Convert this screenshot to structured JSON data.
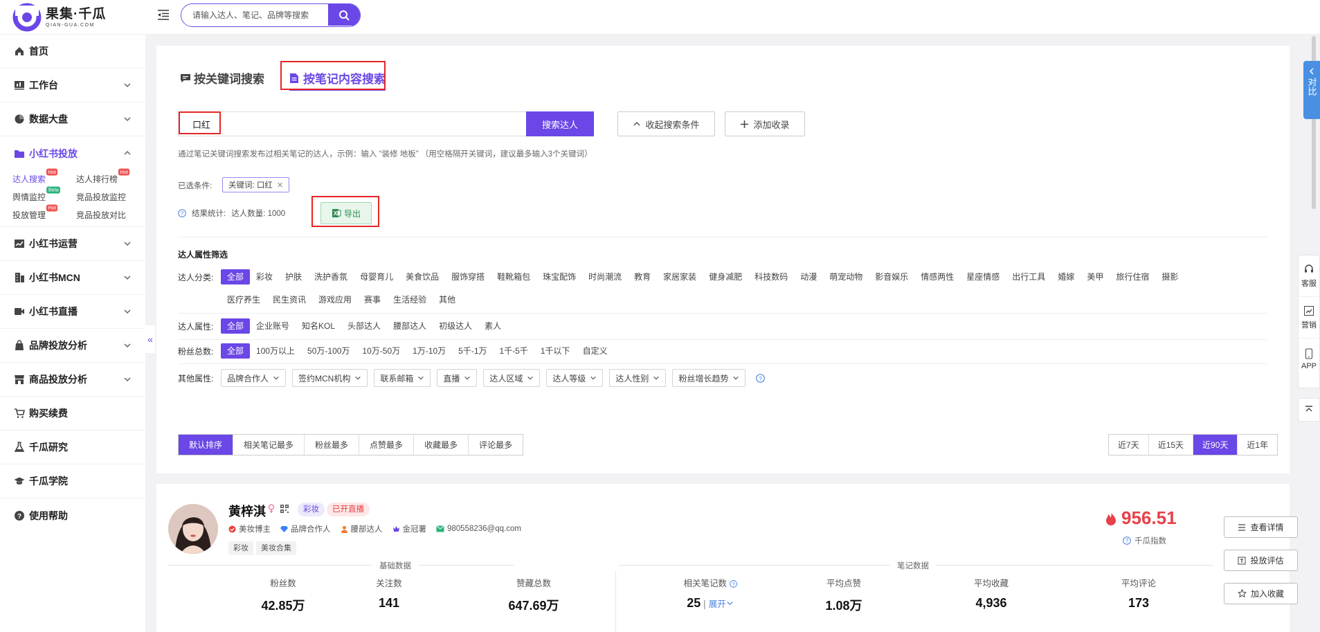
{
  "brand": {
    "cn": "果集·千瓜",
    "en": "QIAN-GUA.COM",
    "color": "#6a47e6"
  },
  "header": {
    "search_placeholder": "请输入达人、笔记、品牌等搜索"
  },
  "sidebar": {
    "items": [
      {
        "label": "首页",
        "icon": "home-icon"
      },
      {
        "label": "工作台",
        "icon": "dashboard-icon"
      },
      {
        "label": "数据大盘",
        "icon": "pie-chart-icon"
      },
      {
        "label": "小红书投放",
        "icon": "folder-icon"
      },
      {
        "label": "小红书运营",
        "icon": "trend-icon"
      },
      {
        "label": "小红书MCN",
        "icon": "building-icon"
      },
      {
        "label": "小红书直播",
        "icon": "video-icon"
      },
      {
        "label": "品牌投放分析",
        "icon": "bag-icon"
      },
      {
        "label": "商品投放分析",
        "icon": "store-icon"
      },
      {
        "label": "购买续费",
        "icon": "cart-icon"
      },
      {
        "label": "千瓜研究",
        "icon": "flask-icon"
      },
      {
        "label": "千瓜学院",
        "icon": "graduation-cap-icon"
      },
      {
        "label": "使用帮助",
        "icon": "help-icon"
      }
    ],
    "sub_items": [
      {
        "label": "达人搜索",
        "tag": "Hot"
      },
      {
        "label": "达人排行榜",
        "tag": "Hot"
      },
      {
        "label": "舆情监控",
        "tag": "Beta"
      },
      {
        "label": "竞品投放监控",
        "tag": ""
      },
      {
        "label": "投放管理",
        "tag": "Hot"
      },
      {
        "label": "竞品投放对比",
        "tag": ""
      }
    ]
  },
  "tabs": {
    "keyword": "按关键词搜索",
    "note": "按笔记内容搜索"
  },
  "search": {
    "value": "口红",
    "button": "搜索达人",
    "collapse": "收起搜索条件",
    "add_fav": "添加收录",
    "hint": "通过笔记关键词搜索发布过相关笔记的达人，示例：输入 “装修 地板” （用空格隔开关键词，建议最多输入3个关键词）"
  },
  "selected": {
    "label": "已选条件:",
    "chip": "关键词: 口红"
  },
  "result": {
    "label": "结果统计:",
    "count_text": "达人数量: 1000",
    "export": "导出"
  },
  "filters": {
    "title": "达人属性筛选",
    "category": {
      "label": "达人分类:",
      "options": [
        "全部",
        "彩妆",
        "护肤",
        "洗护香氛",
        "母婴育儿",
        "美食饮品",
        "服饰穿搭",
        "鞋靴箱包",
        "珠宝配饰",
        "时尚潮流",
        "教育",
        "家居家装",
        "健身减肥",
        "科技数码",
        "动漫",
        "萌宠动物",
        "影音娱乐",
        "情感两性",
        "星座情感",
        "出行工具",
        "婚嫁",
        "美甲",
        "旅行住宿",
        "摄影"
      ],
      "options2": [
        "医疗养生",
        "民生资讯",
        "游戏应用",
        "赛事",
        "生活经验",
        "其他"
      ]
    },
    "attr": {
      "label": "达人属性:",
      "options": [
        "全部",
        "企业账号",
        "知名KOL",
        "头部达人",
        "腰部达人",
        "初级达人",
        "素人"
      ]
    },
    "fans": {
      "label": "粉丝总数:",
      "options": [
        "全部",
        "100万以上",
        "50万-100万",
        "10万-50万",
        "1万-10万",
        "5千-1万",
        "1千-5千",
        "1千以下",
        "自定义"
      ]
    },
    "other": {
      "label": "其他属性:",
      "options": [
        "品牌合作人",
        "签约MCN机构",
        "联系邮箱",
        "直播",
        "达人区域",
        "达人等级",
        "达人性别",
        "粉丝增长趋势"
      ]
    }
  },
  "sort": [
    "默认排序",
    "相关笔记最多",
    "粉丝最多",
    "点赞最多",
    "收藏最多",
    "评论最多"
  ],
  "days": [
    "近7天",
    "近15天",
    "近90天",
    "近1年"
  ],
  "kol": {
    "name": "黄梓淇",
    "tag_category": "彩妆",
    "tag_live": "已开直播",
    "meta": [
      "美妆博主",
      "品牌合作人",
      "腰部达人",
      "金冠薯",
      "980558236@qq.com"
    ],
    "content_tags": [
      "彩妆",
      "美妆合集"
    ],
    "score": "956.51",
    "score_label": "千瓜指数",
    "actions": [
      "查看详情",
      "投放评估",
      "加入收藏"
    ],
    "basic_title": "基础数据",
    "notes_title": "笔记数据",
    "metrics": [
      {
        "label": "粉丝数",
        "value": "42.85万"
      },
      {
        "label": "关注数",
        "value": "141"
      },
      {
        "label": "赞藏总数",
        "value": "647.69万"
      },
      {
        "label": "相关笔记数",
        "value": "25"
      },
      {
        "label": "平均点赞",
        "value": "1.08万"
      },
      {
        "label": "平均收藏",
        "value": "4,936"
      },
      {
        "label": "平均评论",
        "value": "173"
      }
    ],
    "expand": "展开"
  },
  "float": {
    "compare": "对比",
    "service": "客服",
    "marketing": "营销",
    "app": "APP"
  }
}
